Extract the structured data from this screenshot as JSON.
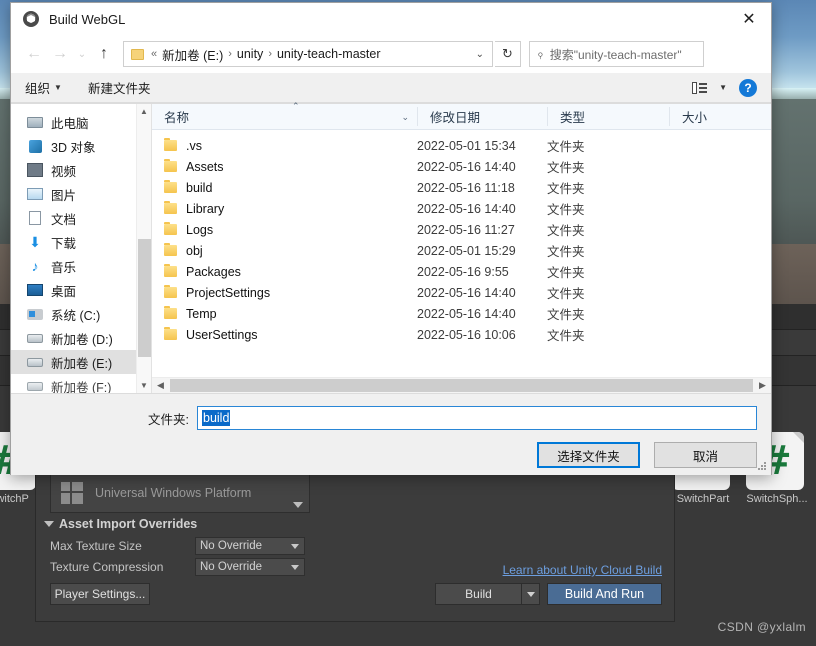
{
  "dialog": {
    "title": "Build WebGL",
    "close_label": "✕",
    "nav": {
      "back": "←",
      "forward": "→",
      "history": "⌄",
      "up": "↑",
      "refresh": "↻"
    },
    "address": {
      "prefix": "«",
      "crumbs": [
        "新加卷 (E:)",
        "unity",
        "unity-teach-master"
      ],
      "separator": "›",
      "caret": "⌄"
    },
    "search": {
      "placeholder": "搜索\"unity-teach-master\"",
      "icon": "⌕"
    },
    "toolbar": {
      "organize": "组织",
      "new_folder": "新建文件夹",
      "caret": "▼",
      "help": "?"
    },
    "sidebar": {
      "items": [
        {
          "label": "此电脑",
          "icon": "pc-icon",
          "selected": false
        },
        {
          "label": "3D 对象",
          "icon": "3d-objects-icon",
          "selected": false
        },
        {
          "label": "视频",
          "icon": "videos-icon",
          "selected": false
        },
        {
          "label": "图片",
          "icon": "pictures-icon",
          "selected": false
        },
        {
          "label": "文档",
          "icon": "documents-icon",
          "selected": false
        },
        {
          "label": "下载",
          "icon": "downloads-icon",
          "selected": false
        },
        {
          "label": "音乐",
          "icon": "music-icon",
          "selected": false
        },
        {
          "label": "桌面",
          "icon": "desktop-icon",
          "selected": false
        },
        {
          "label": "系统 (C:)",
          "icon": "system-drive-icon",
          "selected": false
        },
        {
          "label": "新加卷 (D:)",
          "icon": "drive-icon",
          "selected": false
        },
        {
          "label": "新加卷 (E:)",
          "icon": "drive-icon",
          "selected": true
        },
        {
          "label": "新加卷 (F:)",
          "icon": "drive-icon",
          "selected": false
        }
      ]
    },
    "columns": {
      "name": "名称",
      "date": "修改日期",
      "type": "类型",
      "size": "大小",
      "sort_indicator": "⌃",
      "dropdown": "⌄"
    },
    "files": [
      {
        "name": ".vs",
        "date": "2022-05-01 15:34",
        "type": "文件夹",
        "size": ""
      },
      {
        "name": "Assets",
        "date": "2022-05-16 14:40",
        "type": "文件夹",
        "size": ""
      },
      {
        "name": "build",
        "date": "2022-05-16 11:18",
        "type": "文件夹",
        "size": ""
      },
      {
        "name": "Library",
        "date": "2022-05-16 14:40",
        "type": "文件夹",
        "size": ""
      },
      {
        "name": "Logs",
        "date": "2022-05-16 11:27",
        "type": "文件夹",
        "size": ""
      },
      {
        "name": "obj",
        "date": "2022-05-01 15:29",
        "type": "文件夹",
        "size": ""
      },
      {
        "name": "Packages",
        "date": "2022-05-16 9:55",
        "type": "文件夹",
        "size": ""
      },
      {
        "name": "ProjectSettings",
        "date": "2022-05-16 14:40",
        "type": "文件夹",
        "size": ""
      },
      {
        "name": "Temp",
        "date": "2022-05-16 14:40",
        "type": "文件夹",
        "size": ""
      },
      {
        "name": "UserSettings",
        "date": "2022-05-16 10:06",
        "type": "文件夹",
        "size": ""
      }
    ],
    "footer": {
      "folder_label": "文件夹:",
      "folder_value": "build",
      "select_button": "选择文件夹",
      "cancel_button": "取消"
    }
  },
  "unity": {
    "platform": "Universal Windows Platform",
    "section_title": "Asset Import Overrides",
    "max_texture_label": "Max Texture Size",
    "max_texture_value": "No Override",
    "texture_compression_label": "Texture Compression",
    "texture_compression_value": "No Override",
    "player_settings": "Player Settings...",
    "cloud_link": "Learn about Unity Cloud Build",
    "build_button": "Build",
    "build_and_run_button": "Build And Run",
    "assets": [
      {
        "label": "SwitchP",
        "glyph": "#"
      },
      {
        "label": "SwitchPart",
        "glyph": ""
      },
      {
        "label": "SwitchSph...",
        "glyph": "#"
      }
    ],
    "watermark": "CSDN @yxlalm",
    "accent": "#4a6c94"
  }
}
